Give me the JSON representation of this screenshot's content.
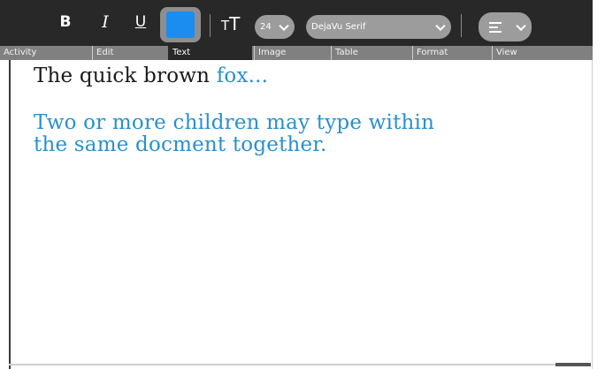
{
  "toolbar": {
    "bold_label": "B",
    "italic_label": "I",
    "underline_label": "U",
    "text_color": "#1b8df0",
    "textsize_icon_small": "T",
    "textsize_icon_big": "T",
    "font_size": "24",
    "font_name": "DejaVu Serif",
    "alignment_icon": "align-left-icon"
  },
  "tabs": [
    {
      "label": "Activity"
    },
    {
      "label": "Edit"
    },
    {
      "label": "Text",
      "active": true
    },
    {
      "label": "Image"
    },
    {
      "label": "Table"
    },
    {
      "label": "Format"
    },
    {
      "label": "View"
    }
  ],
  "document": {
    "line1_black": "The quick brown ",
    "line1_blue": "fox...",
    "line2": "Two or more children may type within",
    "line3": "the same docment together."
  },
  "colors": {
    "toolbar_bg": "#282828",
    "tab_bar_bg": "#808080",
    "text_blue": "#2891cf",
    "text_black": "#1a1a1a"
  }
}
